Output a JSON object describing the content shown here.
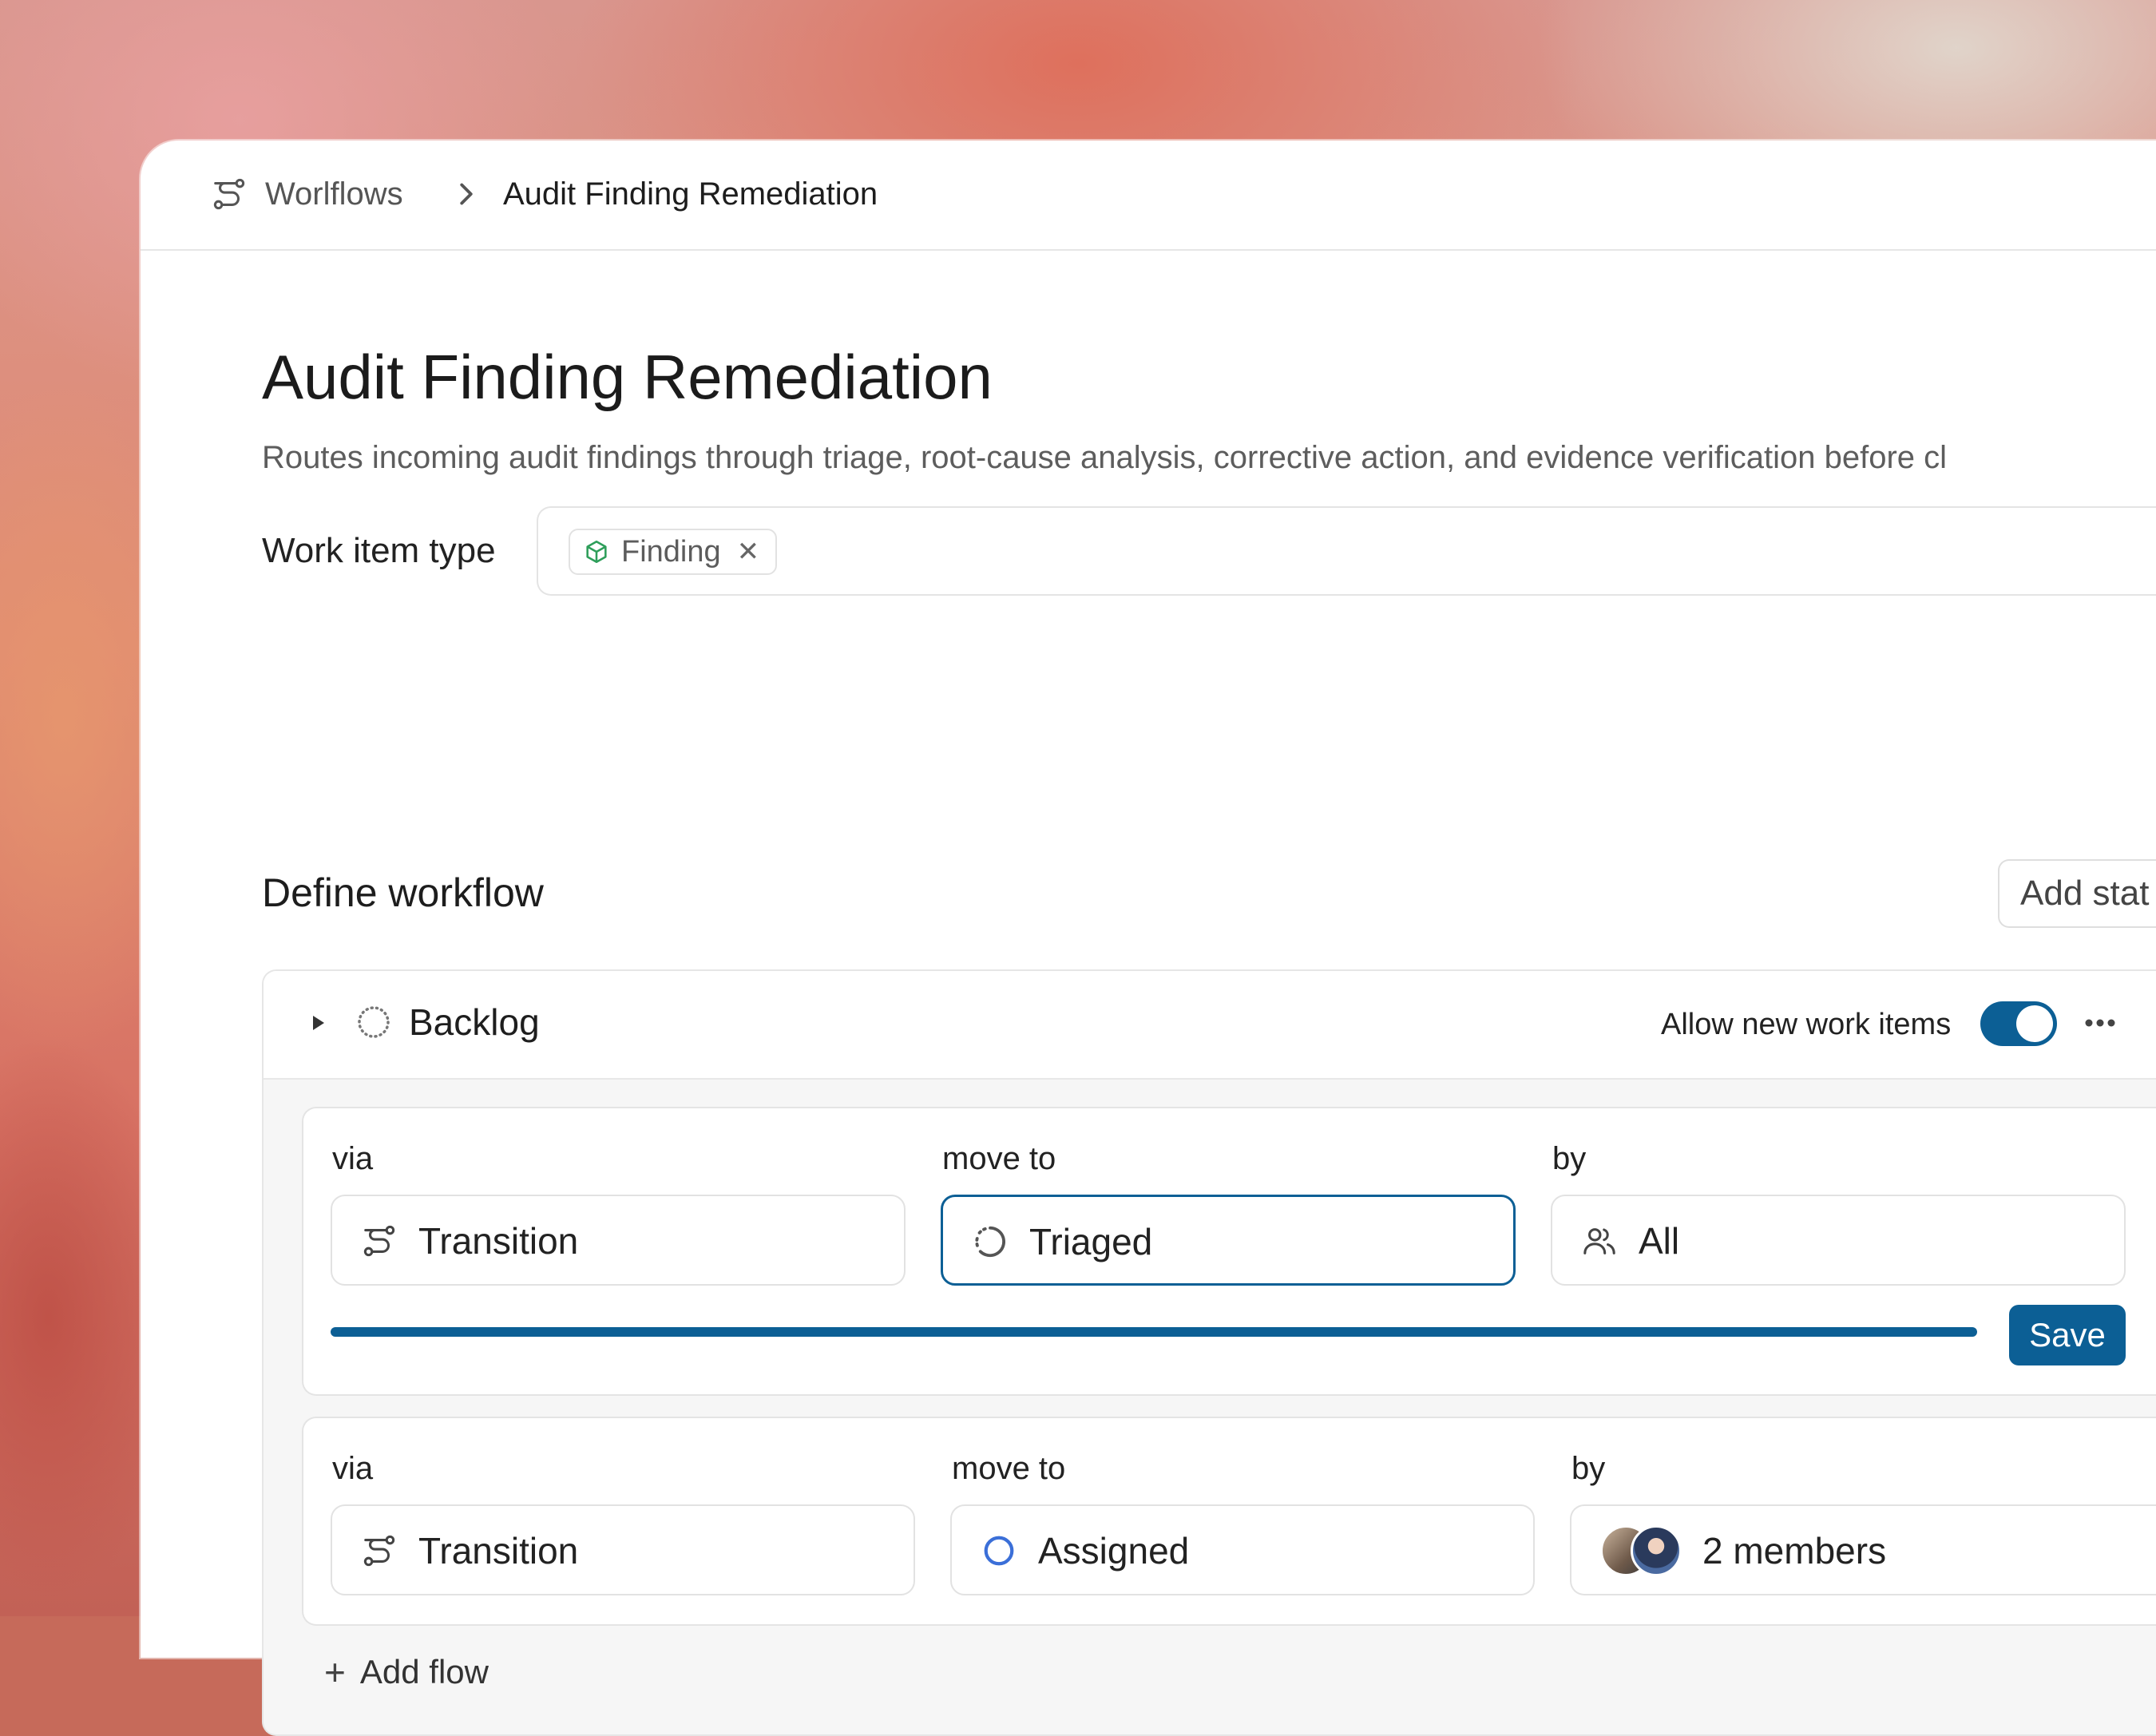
{
  "breadcrumb": {
    "root_icon": "workflow-icon",
    "root_label": "Worlflows",
    "separator_icon": "chevron-right-icon",
    "current_label": "Audit Finding Remediation"
  },
  "page": {
    "title": "Audit Finding Remediation",
    "description": "Routes incoming audit findings through triage, root-cause analysis, corrective action, and evidence verification before cl"
  },
  "work_item_type": {
    "label": "Work item type",
    "chip": {
      "icon": "cube-icon",
      "label": "Finding",
      "remove_icon": "close-icon"
    }
  },
  "workflow": {
    "title": "Define workflow",
    "add_stage_label": "Add stat"
  },
  "stage": {
    "name": "Backlog",
    "icon": "dotted-circle-icon",
    "allow_label": "Allow new work items",
    "allow_enabled": true,
    "flows": [
      {
        "via_label": "via",
        "via_value": "Transition",
        "move_label": "move to",
        "move_value": "Triaged",
        "by_label": "by",
        "by_value": "All",
        "save_label": "Save",
        "progress": 1.0
      },
      {
        "via_label": "via",
        "via_value": "Transition",
        "move_label": "move to",
        "move_value": "Assigned",
        "by_label": "by",
        "by_value": "2 members"
      }
    ],
    "add_flow_label": "Add flow"
  },
  "colors": {
    "accent": "#0c5f95",
    "chip_icon": "#2e9e5a",
    "assigned_ring": "#3b6fd8"
  }
}
